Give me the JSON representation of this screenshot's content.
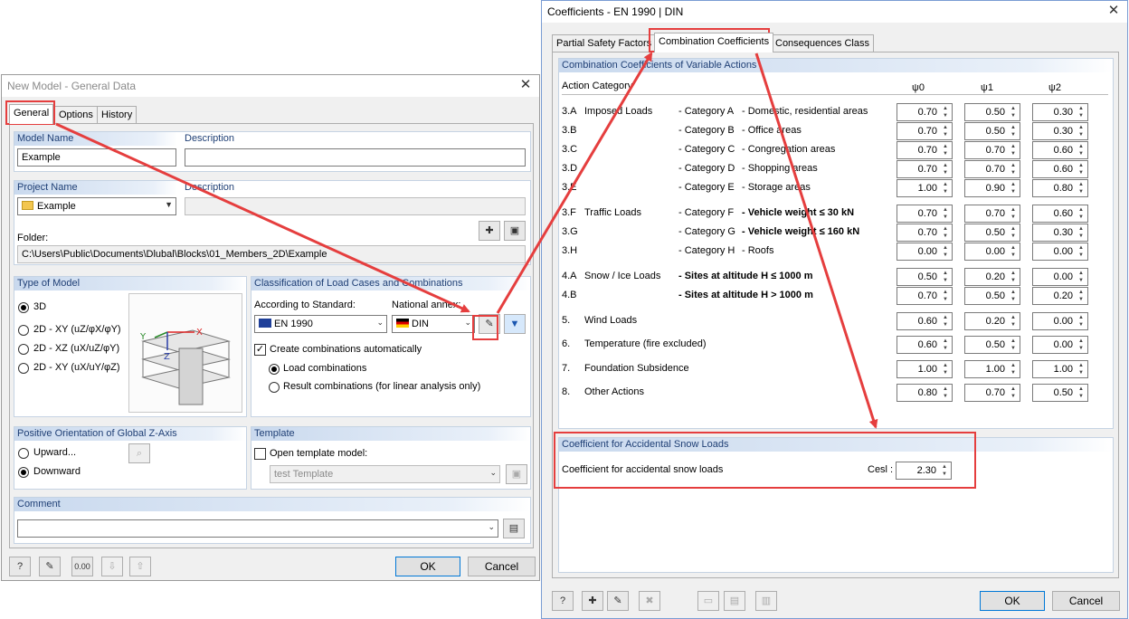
{
  "new_model": {
    "title": "New Model - General Data",
    "tabs": [
      "General",
      "Options",
      "History"
    ],
    "model_name_label": "Model Name",
    "model_name_value": "Example",
    "description_label": "Description",
    "description_value": "",
    "project_name_label": "Project Name",
    "project_name_value": "Example",
    "project_description_label": "Description",
    "folder_label": "Folder:",
    "folder_value": "C:\\Users\\Public\\Documents\\Dlubal\\Blocks\\01_Members_2D\\Example",
    "type_of_model": {
      "header": "Type of Model",
      "options": [
        "3D",
        "2D - XY (uZ/φX/φY)",
        "2D - XZ (uX/uZ/φY)",
        "2D - XY (uX/uY/φZ)"
      ],
      "selected": 0
    },
    "classification": {
      "header": "Classification of Load Cases and Combinations",
      "standard_label": "According to Standard:",
      "standard_value": "EN 1990",
      "annex_label": "National annex:",
      "annex_value": "DIN",
      "create_label": "Create combinations automatically",
      "load_combinations": "Load combinations",
      "result_combinations": "Result combinations (for linear analysis only)"
    },
    "orientation": {
      "header": "Positive Orientation of Global Z-Axis",
      "upward": "Upward...",
      "downward": "Downward"
    },
    "template": {
      "header": "Template",
      "open_label": "Open template model:",
      "value": "test Template"
    },
    "comment_label": "Comment",
    "ok": "OK",
    "cancel": "Cancel"
  },
  "coefficients": {
    "title": "Coefficients - EN 1990 | DIN",
    "tabs": [
      "Partial Safety Factors",
      "Combination Coefficients",
      "Consequences Class"
    ],
    "section_header": "Combination Coefficients of Variable Actions",
    "col_action": "Action Category",
    "col_psi0": "ψ0",
    "col_psi1": "ψ1",
    "col_psi2": "ψ2",
    "rows": [
      {
        "code": "3.A",
        "group": "Imposed Loads",
        "cat": "- Category A",
        "desc": "- Domestic, residential areas",
        "bold": false,
        "p0": "0.70",
        "p1": "0.50",
        "p2": "0.30"
      },
      {
        "code": "3.B",
        "group": "",
        "cat": "- Category B",
        "desc": "- Office areas",
        "bold": false,
        "p0": "0.70",
        "p1": "0.50",
        "p2": "0.30"
      },
      {
        "code": "3.C",
        "group": "",
        "cat": "- Category C",
        "desc": "- Congregation areas",
        "bold": false,
        "p0": "0.70",
        "p1": "0.70",
        "p2": "0.60"
      },
      {
        "code": "3.D",
        "group": "",
        "cat": "- Category D",
        "desc": "- Shopping areas",
        "bold": false,
        "p0": "0.70",
        "p1": "0.70",
        "p2": "0.60"
      },
      {
        "code": "3.E",
        "group": "",
        "cat": "- Category E",
        "desc": "- Storage areas",
        "bold": false,
        "p0": "1.00",
        "p1": "0.90",
        "p2": "0.80"
      },
      {
        "code": "3.F",
        "group": "Traffic Loads",
        "cat": "- Category F",
        "desc": "- Vehicle weight ≤ 30 kN",
        "bold": true,
        "p0": "0.70",
        "p1": "0.70",
        "p2": "0.60"
      },
      {
        "code": "3.G",
        "group": "",
        "cat": "- Category G",
        "desc": "- Vehicle weight ≤ 160 kN",
        "bold": true,
        "p0": "0.70",
        "p1": "0.50",
        "p2": "0.30"
      },
      {
        "code": "3.H",
        "group": "",
        "cat": "- Category H",
        "desc": "- Roofs",
        "bold": false,
        "p0": "0.00",
        "p1": "0.00",
        "p2": "0.00"
      },
      {
        "code": "4.A",
        "group": "Snow / Ice Loads",
        "cat": "- Sites at altitude H ≤ 1000 m",
        "desc": "",
        "bold": true,
        "p0": "0.50",
        "p1": "0.20",
        "p2": "0.00"
      },
      {
        "code": "4.B",
        "group": "",
        "cat": "- Sites at altitude H > 1000 m",
        "desc": "",
        "bold": true,
        "p0": "0.70",
        "p1": "0.50",
        "p2": "0.20"
      },
      {
        "code": "5.",
        "group": "Wind Loads",
        "cat": "",
        "desc": "",
        "bold": false,
        "p0": "0.60",
        "p1": "0.20",
        "p2": "0.00"
      },
      {
        "code": "6.",
        "group": "Temperature (fire excluded)",
        "cat": "",
        "desc": "",
        "bold": false,
        "p0": "0.60",
        "p1": "0.50",
        "p2": "0.00"
      },
      {
        "code": "7.",
        "group": "Foundation Subsidence",
        "cat": "",
        "desc": "",
        "bold": false,
        "p0": "1.00",
        "p1": "1.00",
        "p2": "1.00"
      },
      {
        "code": "8.",
        "group": "Other Actions",
        "cat": "",
        "desc": "",
        "bold": false,
        "p0": "0.80",
        "p1": "0.70",
        "p2": "0.50"
      }
    ],
    "snow_header": "Coefficient for Accidental Snow Loads",
    "snow_label": "Coefficient for accidental snow loads",
    "snow_symbol": "Cesl :",
    "snow_value": "2.30",
    "ok": "OK",
    "cancel": "Cancel"
  },
  "colors": {
    "highlight": "#e53e3e",
    "group_header_text": "#1f3f75",
    "default_button_border": "#0078d7"
  }
}
